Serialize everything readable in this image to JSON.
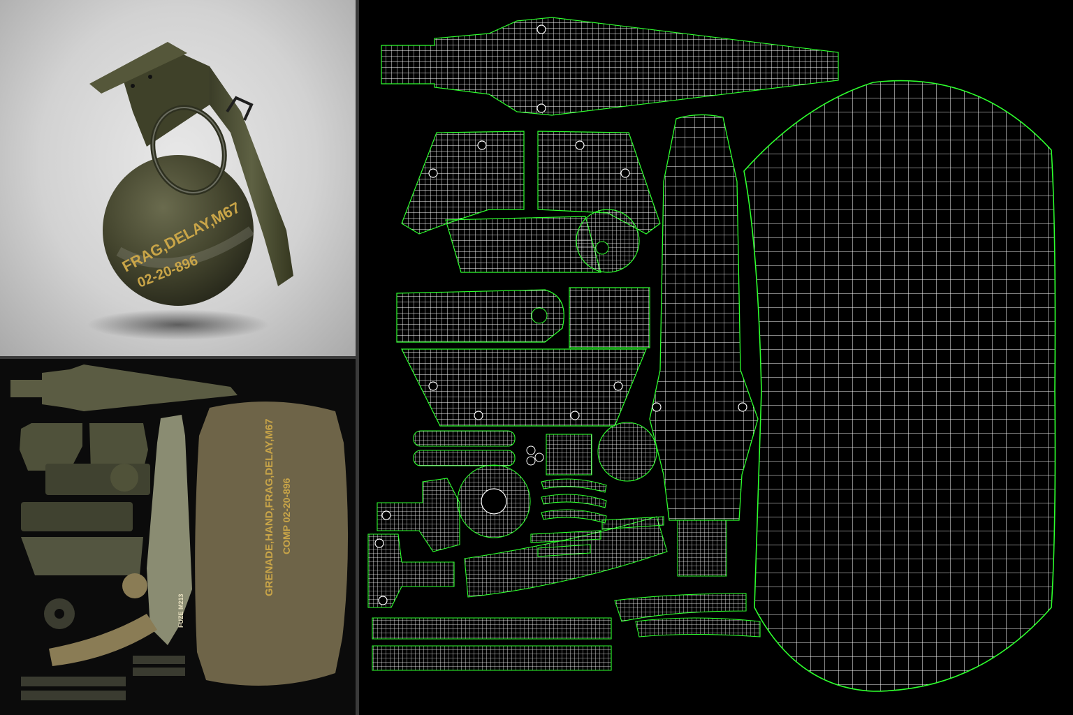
{
  "render": {
    "label_line1": "FRAG,DELAY,M67",
    "label_line2": "02-20-896"
  },
  "texture": {
    "body_label_line1": "GRENADE,HAND,FRAG,DELAY,M67",
    "body_label_line2": "COMP 02-20-896",
    "fuze_label": "FUZE M213"
  },
  "colors": {
    "olive": "#4b4d32",
    "olive_light": "#6a6b4e",
    "tan": "#6e6448",
    "stencil": "#c9a548",
    "wire_white": "#ffffff",
    "wire_green": "#2dff2d"
  }
}
